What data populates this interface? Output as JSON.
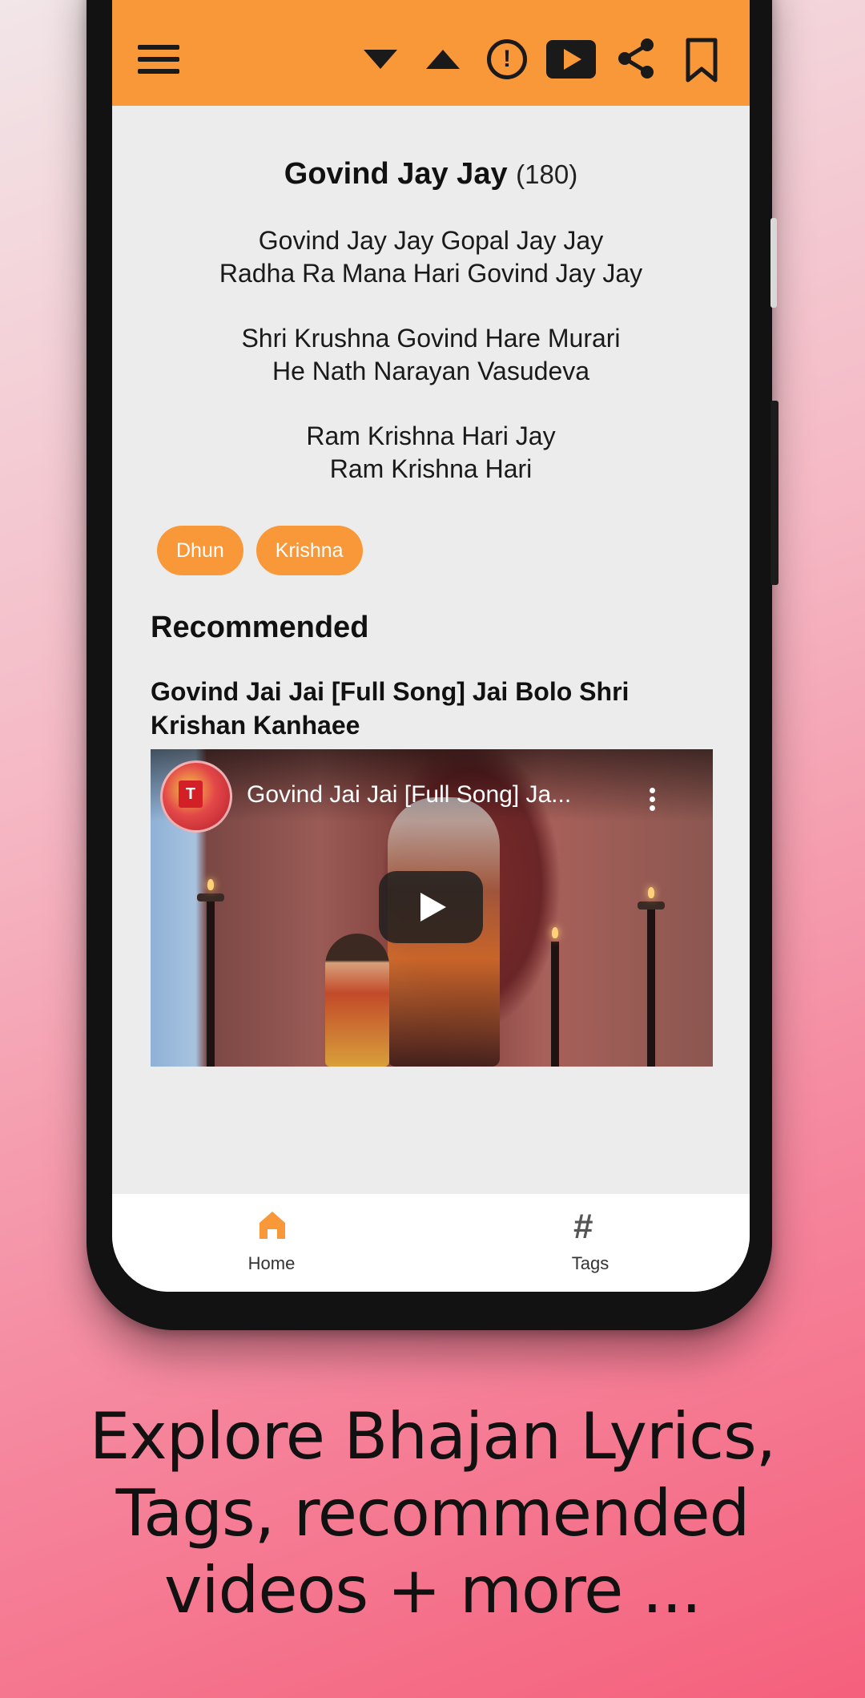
{
  "app_bar": {
    "icons": [
      "menu-icon",
      "arrow-down-icon",
      "arrow-up-icon",
      "alert-icon",
      "youtube-play-icon",
      "share-icon",
      "bookmark-icon"
    ],
    "color": "#f99838"
  },
  "song": {
    "title": "Govind Jay Jay",
    "count": "(180)",
    "stanzas": [
      [
        "Govind Jay Jay Gopal Jay Jay",
        "Radha Ra Mana Hari Govind Jay Jay"
      ],
      [
        "Shri Krushna Govind Hare Murari",
        "He Nath Narayan Vasudeva"
      ],
      [
        "Ram Krishna Hari Jay",
        "Ram Krishna Hari"
      ]
    ]
  },
  "tags": [
    "Dhun",
    "Krishna"
  ],
  "recommended": {
    "heading": "Recommended",
    "video_title": "Govind Jai Jai [Full Song] Jai Bolo Shri Krishan Kanhaee",
    "player_title": "Govind Jai Jai [Full Song] Ja..."
  },
  "bottom_nav": {
    "home": "Home",
    "tags": "Tags",
    "active_color": "#f99838"
  },
  "caption": {
    "line1": "Explore Bhajan Lyrics,",
    "line2": "Tags, recommended",
    "line3": "videos + more ..."
  }
}
